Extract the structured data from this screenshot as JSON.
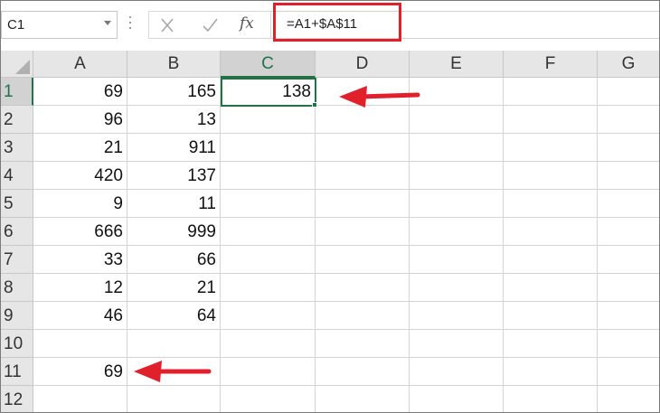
{
  "name_box": {
    "value": "C1",
    "icon": "chevron-down-icon"
  },
  "formula_bar": {
    "cancel_icon": "close-icon",
    "enter_icon": "check-icon",
    "fx_label": "fx",
    "formula": "=A1+$A$11"
  },
  "columns": [
    "A",
    "B",
    "C",
    "D",
    "E",
    "F",
    "G"
  ],
  "rows": [
    "1",
    "2",
    "3",
    "4",
    "5",
    "6",
    "7",
    "8",
    "9",
    "10",
    "11",
    "12"
  ],
  "cells": {
    "A": [
      "69",
      "96",
      "21",
      "420",
      "9",
      "666",
      "33",
      "12",
      "46",
      "",
      "69",
      ""
    ],
    "B": [
      "165",
      "13",
      "911",
      "137",
      "11",
      "999",
      "66",
      "21",
      "64",
      "",
      "",
      ""
    ],
    "C": [
      "138",
      "",
      "",
      "",
      "",
      "",
      "",
      "",
      "",
      "",
      "",
      ""
    ]
  },
  "active_cell": "C1",
  "colors": {
    "highlight": "#e0202a",
    "selection": "#217346"
  }
}
